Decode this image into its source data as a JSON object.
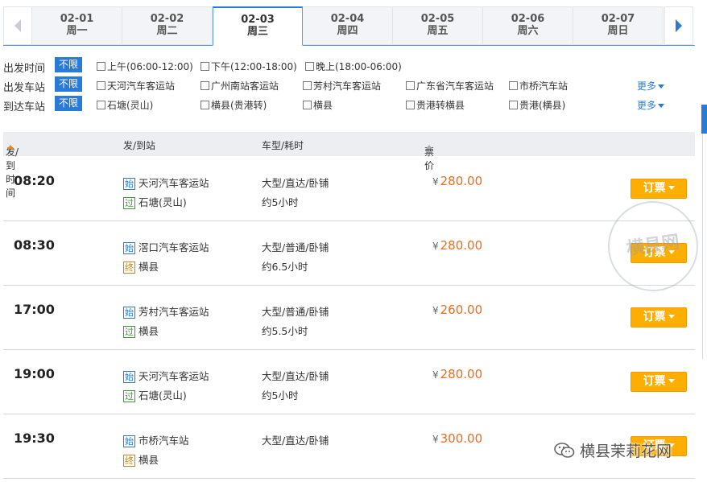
{
  "date_tabs": [
    {
      "date": "02-01",
      "weekday": "周一"
    },
    {
      "date": "02-02",
      "weekday": "周二"
    },
    {
      "date": "02-03",
      "weekday": "周三"
    },
    {
      "date": "02-04",
      "weekday": "周四"
    },
    {
      "date": "02-05",
      "weekday": "周五"
    },
    {
      "date": "02-06",
      "weekday": "周六"
    },
    {
      "date": "02-07",
      "weekday": "周日"
    }
  ],
  "active_date": "02-03",
  "filters": {
    "time": {
      "label": "出发时间",
      "unlimited": "不限",
      "options": [
        "上午(06:00-12:00)",
        "下午(12:00-18:00)",
        "晚上(18:00-06:00)"
      ]
    },
    "depart": {
      "label": "出发车站",
      "unlimited": "不限",
      "options": [
        "天河汽车客运站",
        "广州南站客运站",
        "芳村汽车客运站",
        "广东省汽车客运站",
        "市桥汽车站"
      ],
      "more": "更多"
    },
    "arrive": {
      "label": "到达车站",
      "unlimited": "不限",
      "options": [
        "石塘(灵山)",
        "横县(贵港转)",
        "横县",
        "贵港转横县",
        "贵港(横县)"
      ],
      "more": "更多"
    }
  },
  "table_header": {
    "time": "发/到时间",
    "station": "发/到站",
    "vehicle": "车型/耗时",
    "price": "票价"
  },
  "trips": [
    {
      "time": "08:20",
      "from_tag": "始",
      "from": "天河汽车客运站",
      "to_tag": "过",
      "to": "石塘(灵山)",
      "vehicle": "大型/直达/卧铺",
      "duration": "约5小时",
      "currency": "¥",
      "price": "280.00",
      "book": "订票"
    },
    {
      "time": "08:30",
      "from_tag": "始",
      "from": "滘口汽车客运站",
      "to_tag": "终",
      "to": "横县",
      "vehicle": "大型/普通/卧铺",
      "duration": "约6.5小时",
      "currency": "¥",
      "price": "280.00",
      "book": "订票"
    },
    {
      "time": "17:00",
      "from_tag": "始",
      "from": "芳村汽车客运站",
      "to_tag": "过",
      "to": "横县",
      "vehicle": "大型/普通/卧铺",
      "duration": "约5.5小时",
      "currency": "¥",
      "price": "260.00",
      "book": "订票"
    },
    {
      "time": "19:00",
      "from_tag": "始",
      "from": "天河汽车客运站",
      "to_tag": "过",
      "to": "石塘(灵山)",
      "vehicle": "大型/直达/卧铺",
      "duration": "约5小时",
      "currency": "¥",
      "price": "280.00",
      "book": "订票"
    },
    {
      "time": "19:30",
      "from_tag": "始",
      "from": "市桥汽车站",
      "to_tag": "终",
      "to": "横县",
      "vehicle": "大型/直达/卧铺",
      "duration": "",
      "currency": "¥",
      "price": "300.00",
      "book": "订票"
    }
  ],
  "watermark": {
    "text": "横县茉莉花网",
    "stamp": "横县网"
  },
  "colors": {
    "accent": "#2a7bd8",
    "price": "#f06a1a",
    "book_button": "#ffae00"
  }
}
